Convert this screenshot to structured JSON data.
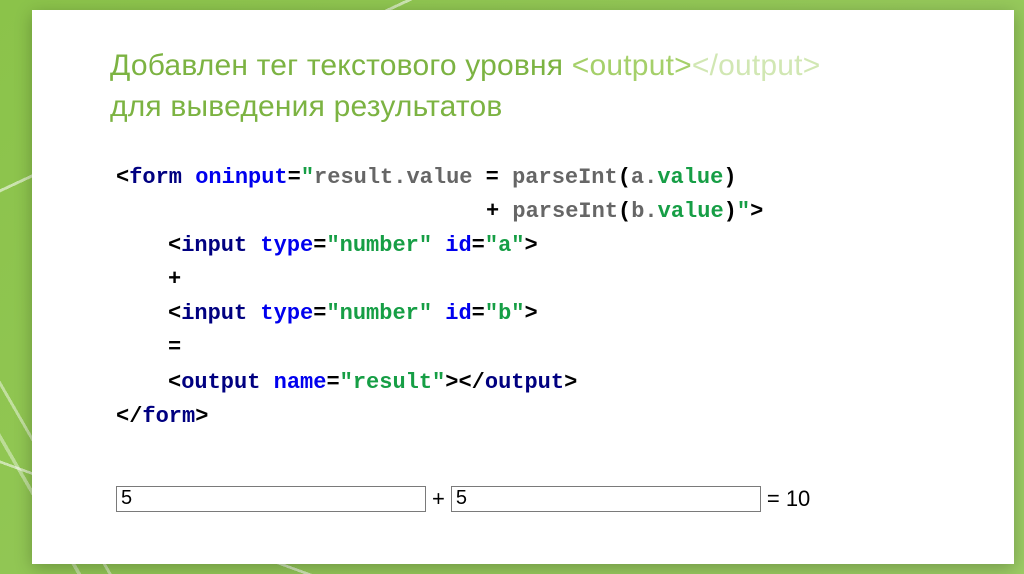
{
  "title": {
    "part1": "Добавлен тег текстового уровня ",
    "tag_open": "<output>",
    "tag_close": "</output>",
    "part2": "для выведения результатов"
  },
  "code": {
    "l1_a": "<",
    "l1_form": "form",
    "l1_sp": " ",
    "l1_oninput": "oninput",
    "l1_eq": "=",
    "l1_q1": "\"",
    "l1_result": "result.value",
    "l1_assign": " = ",
    "l1_parse1": "parseInt",
    "l1_paren1o": "(",
    "l1_avalue": "a.",
    "l1_avalue2": "value",
    "l1_paren1c": ")",
    "l2_plus": "+ ",
    "l2_parse2": "parseInt",
    "l2_paren2o": "(",
    "l2_bvalue": "b.",
    "l2_bvalue2": "value",
    "l2_paren2c": ")",
    "l2_q2": "\"",
    "l2_close": ">",
    "l3_open": "<",
    "l3_input": "input",
    "l3_type": "type",
    "l3_eq": "=",
    "l3_num": "\"number\"",
    "l3_id": "id",
    "l3_eq2": "=",
    "l3_a": "\"a\"",
    "l3_close": ">",
    "l4_plus": "+",
    "l5_open": "<",
    "l5_input": "input",
    "l5_type": "type",
    "l5_eq": "=",
    "l5_num": "\"number\"",
    "l5_id": "id",
    "l5_eq2": "=",
    "l5_b": "\"b\"",
    "l5_close": ">",
    "l6_eq": "=",
    "l7_open": "<",
    "l7_output": "output",
    "l7_name": "name",
    "l7_eq": "=",
    "l7_result": "\"result\"",
    "l7_close": "></",
    "l7_output2": "output",
    "l7_close2": ">",
    "l8_open": "</",
    "l8_form": "form",
    "l8_close": ">"
  },
  "demo": {
    "input_a": "5",
    "plus": "+",
    "input_b": "5",
    "equals": "= 10"
  }
}
